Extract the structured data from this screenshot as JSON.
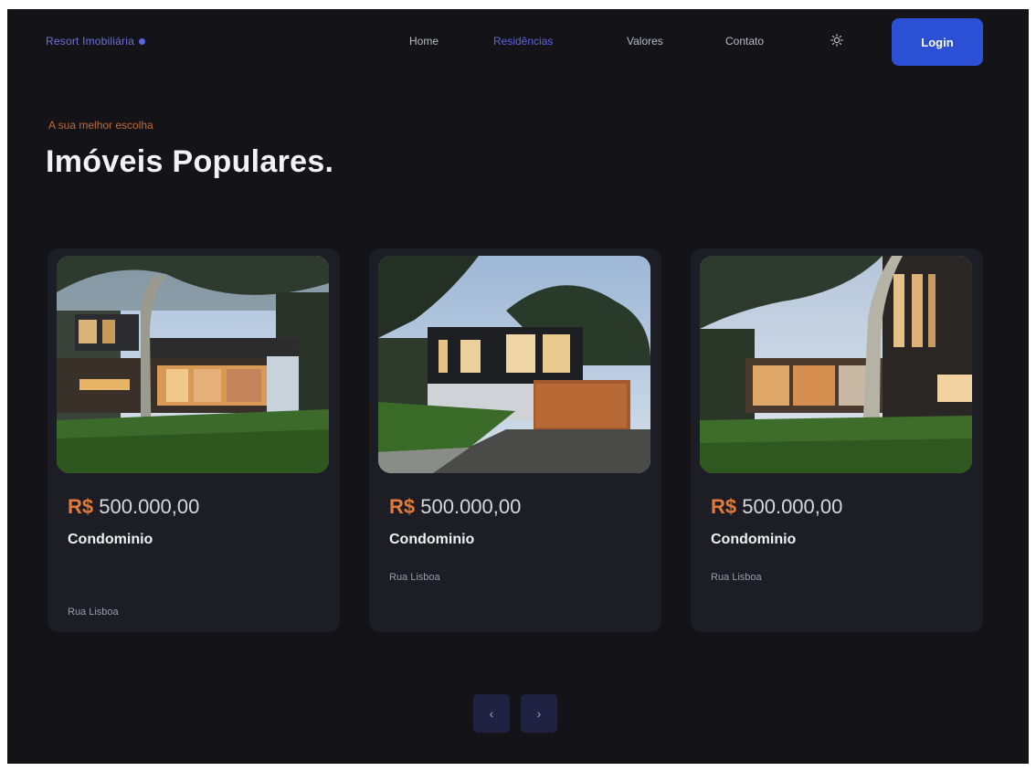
{
  "nav": {
    "brand": "Resort Imobiliária",
    "items": [
      {
        "label": "Home",
        "active": false
      },
      {
        "label": "Residências",
        "active": true
      },
      {
        "label": "Valores",
        "active": false
      },
      {
        "label": "Contato",
        "active": false
      }
    ],
    "theme_icon": "sun-icon",
    "login_label": "Login"
  },
  "hero": {
    "eyebrow": "A sua melhor escolha",
    "title": "Imóveis Populares."
  },
  "listings": [
    {
      "currency": "R$",
      "amount": "500.000,00",
      "name": "Condominio",
      "address": "Rua Lisboa"
    },
    {
      "currency": "R$",
      "amount": "500.000,00",
      "name": "Condominio",
      "address": "Rua Lisboa"
    },
    {
      "currency": "R$",
      "amount": "500.000,00",
      "name": "Condominio",
      "address": "Rua Lisboa"
    }
  ],
  "pagination": {
    "prev_label": "‹",
    "next_label": "›"
  },
  "colors": {
    "background": "#131318",
    "card": "#1c1d25",
    "accent_blue": "#2b50d6",
    "accent_orange": "#e0793a"
  }
}
